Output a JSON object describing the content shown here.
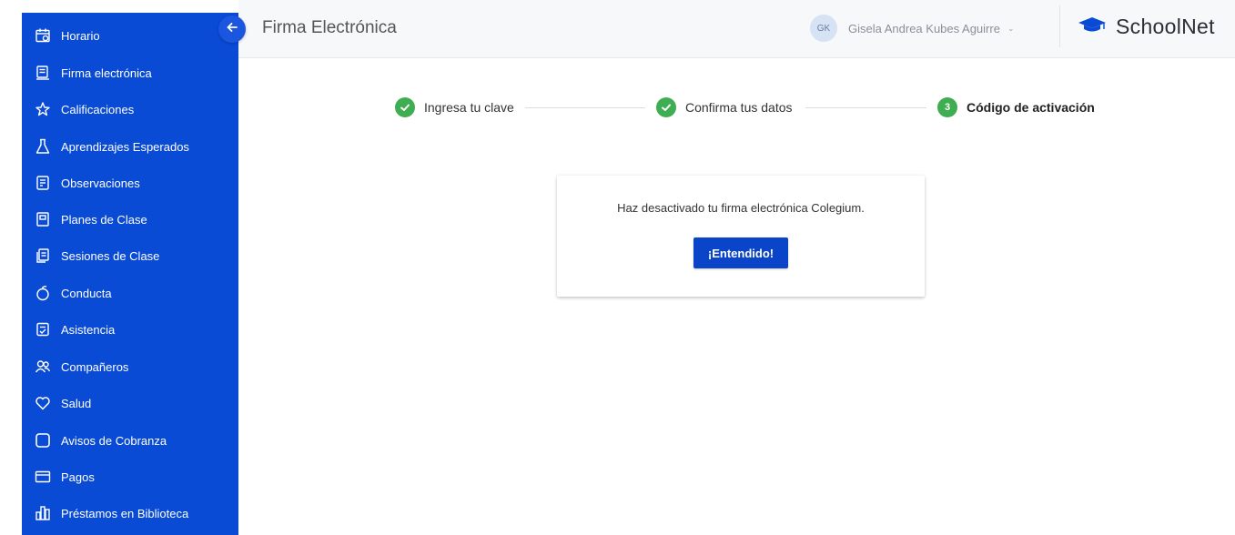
{
  "sidebar": {
    "items": [
      {
        "label": "Horario",
        "icon": "calendar-icon"
      },
      {
        "label": "Firma electrónica",
        "icon": "signature-icon"
      },
      {
        "label": "Calificaciones",
        "icon": "star-icon"
      },
      {
        "label": "Aprendizajes Esperados",
        "icon": "flask-icon"
      },
      {
        "label": "Observaciones",
        "icon": "document-icon"
      },
      {
        "label": "Planes de Clase",
        "icon": "plan-icon"
      },
      {
        "label": "Sesiones de Clase",
        "icon": "sessions-icon"
      },
      {
        "label": "Conducta",
        "icon": "apple-icon"
      },
      {
        "label": "Asistencia",
        "icon": "attendance-icon"
      },
      {
        "label": "Compañeros",
        "icon": "people-icon"
      },
      {
        "label": "Salud",
        "icon": "heart-icon"
      },
      {
        "label": "Avisos de Cobranza",
        "icon": "square-icon"
      },
      {
        "label": "Pagos",
        "icon": "card-icon"
      },
      {
        "label": "Préstamos en Biblioteca",
        "icon": "library-icon"
      }
    ]
  },
  "header": {
    "title": "Firma Electrónica",
    "user": {
      "initials": "GK",
      "name": "Gisela Andrea Kubes Aguirre"
    },
    "brand": "SchoolNet"
  },
  "stepper": {
    "steps": [
      {
        "label": "Ingresa tu clave",
        "status": "done"
      },
      {
        "label": "Confirma tus datos",
        "status": "done"
      },
      {
        "label": "Código de activación",
        "status": "current",
        "number": "3"
      }
    ]
  },
  "dialog": {
    "message": "Haz desactivado tu firma electrónica Colegium.",
    "button_label": "¡Entendido!"
  },
  "colors": {
    "sidebar": "#0a4bd6",
    "accent_button": "#0a44c8",
    "step_done": "#3fae52"
  }
}
